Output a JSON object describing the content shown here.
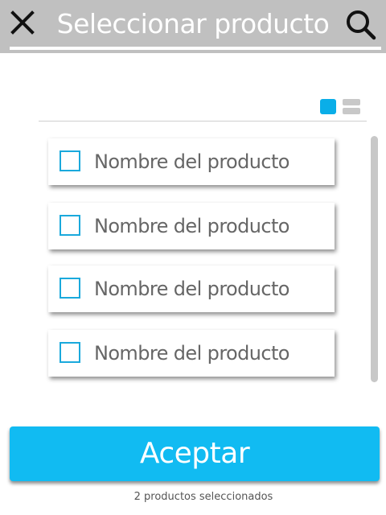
{
  "header": {
    "title": "Seleccionar producto",
    "close_icon": "close-icon",
    "search_icon": "search-icon"
  },
  "view_toggle": {
    "grid_icon": "grid-view-icon",
    "list_icon": "list-view-icon",
    "active": "grid"
  },
  "products": [
    {
      "label": "Nombre del producto",
      "checked": false
    },
    {
      "label": "Nombre del producto",
      "checked": false
    },
    {
      "label": "Nombre del producto",
      "checked": false
    },
    {
      "label": "Nombre del producto",
      "checked": false
    }
  ],
  "footer": {
    "accept_label": "Aceptar",
    "status_text": "2 productos seleccionados"
  },
  "colors": {
    "header_bg": "#c0c0c0",
    "accent": "#11bbf2",
    "checkbox_border": "#1aa9dc"
  }
}
